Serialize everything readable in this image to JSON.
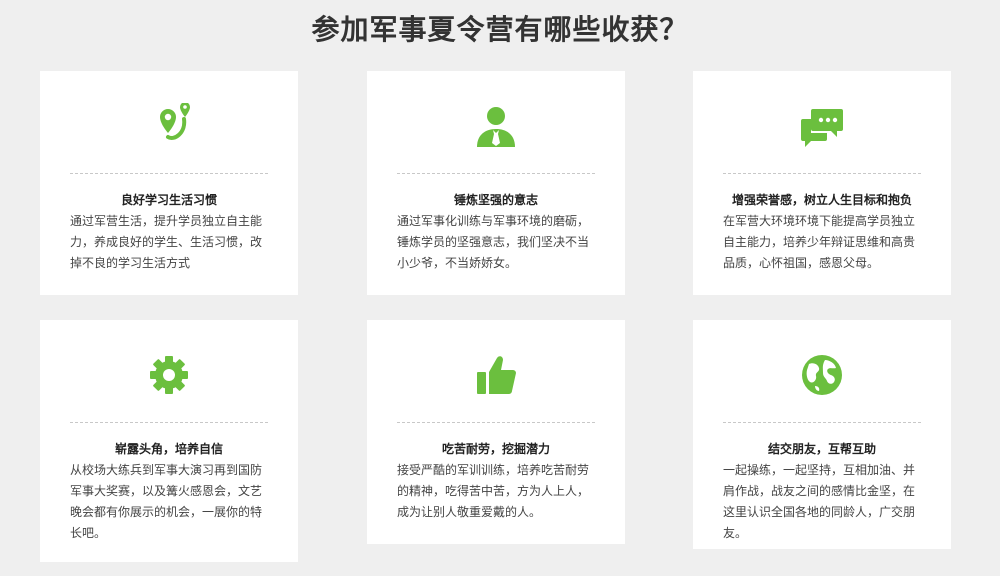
{
  "page": {
    "title": "参加军事夏令营有哪些收获？",
    "accent_color": "#6bbf3e"
  },
  "cards": [
    {
      "icon": "map-pin-route-icon",
      "title": "良好学习生活习惯",
      "desc": "通过军营生活，提升学员独立自主能力，养成良好的学生、生活习惯，改掉不良的学习生活方式"
    },
    {
      "icon": "person-icon",
      "title": "锤炼坚强的意志",
      "desc": "通过军事化训练与军事环境的磨砺，锤炼学员的坚强意志，我们坚决不当小少爷，不当娇娇女。"
    },
    {
      "icon": "chat-bubbles-icon",
      "title": "增强荣誉感，树立人生目标和抱负",
      "desc": "在军营大环境环境下能提高学员独立自主能力，培养少年辩证思维和高贵品质，心怀祖国，感恩父母。"
    },
    {
      "icon": "gear-icon",
      "title": "崭露头角，培养自信",
      "desc": "从校场大练兵到军事大演习再到国防军事大奖赛，以及篝火感恩会，文艺晚会都有你展示的机会，一展你的特长吧。"
    },
    {
      "icon": "thumbs-up-icon",
      "title": "吃苦耐劳，挖掘潜力",
      "desc": "接受严酷的军训训练，培养吃苦耐劳的精神，吃得苦中苦，方为人上人，成为让别人敬重爱戴的人。"
    },
    {
      "icon": "globe-icon",
      "title": "结交朋友，互帮互助",
      "desc": "一起操练，一起坚持，互相加油、并肩作战，战友之间的感情比金坚，在这里认识全国各地的同龄人，广交朋友。"
    }
  ]
}
